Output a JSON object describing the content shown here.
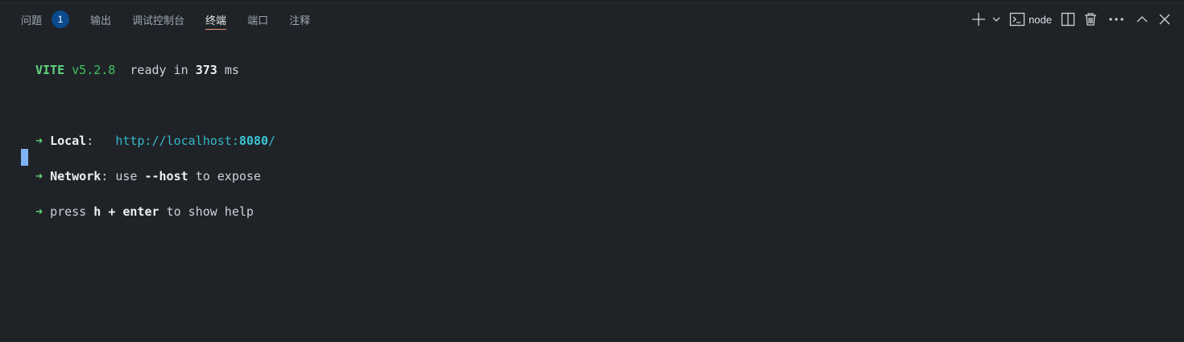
{
  "tabs": [
    {
      "label": "问题",
      "badge": "1"
    },
    {
      "label": "输出"
    },
    {
      "label": "调试控制台"
    },
    {
      "label": "终端",
      "active": true
    },
    {
      "label": "端口"
    },
    {
      "label": "注释"
    }
  ],
  "toolbar": {
    "terminal_name": "node"
  },
  "terminal": {
    "vite_name": "VITE",
    "vite_version": "v5.2.8",
    "ready_text": "ready in",
    "ready_ms": "373",
    "ms": "ms",
    "arrow": "➜",
    "local_label": "Local",
    "local_url_prefix": "http://localhost:",
    "local_port": "8080",
    "local_url_suffix": "/",
    "network_label": "Network",
    "network_use": "use",
    "network_flag": "--host",
    "network_rest": "to expose",
    "press": "press",
    "key_h": "h",
    "plus": "+",
    "key_enter": "enter",
    "help_rest": "to show help"
  }
}
